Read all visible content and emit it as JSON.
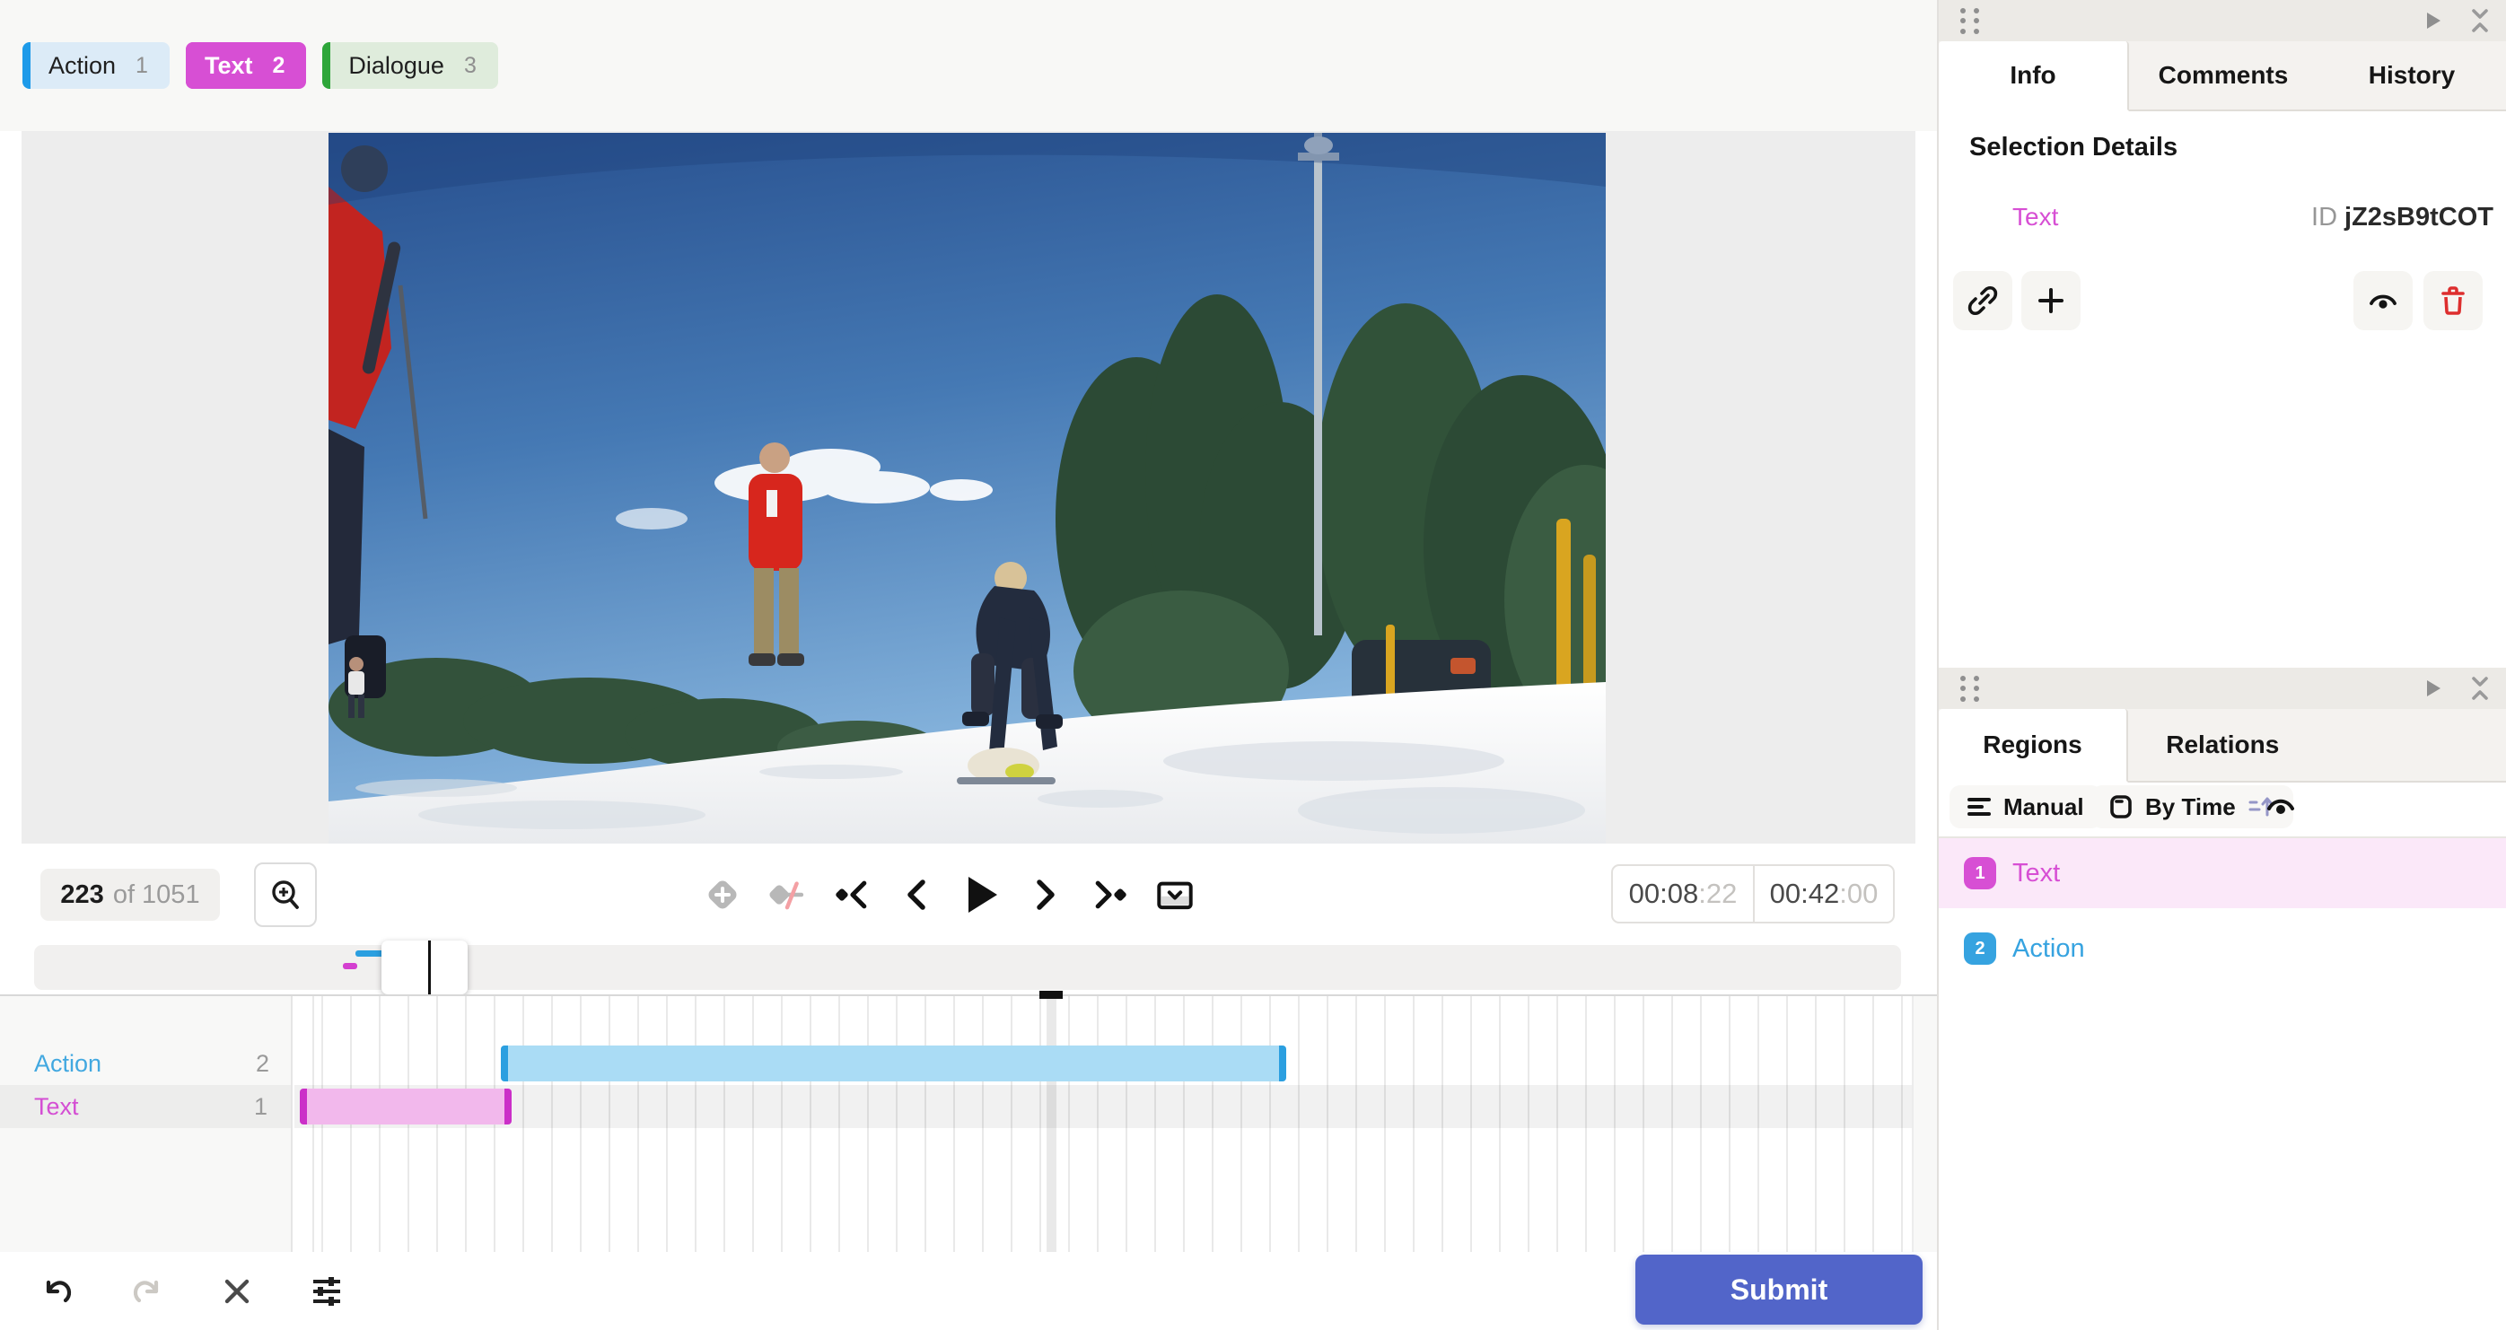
{
  "tags": [
    {
      "label": "Action",
      "count": "1",
      "accent": "#1e9be9",
      "bg": "#dcebf7",
      "selected": false
    },
    {
      "label": "Text",
      "count": "2",
      "accent": "#d74fd4",
      "bg": "#d74fd4",
      "selected": true
    },
    {
      "label": "Dialogue",
      "count": "3",
      "accent": "#2ea63a",
      "bg": "#dfecdc",
      "selected": false
    }
  ],
  "player": {
    "frame_current": "223",
    "frame_total_label": "of 1051",
    "time_position": {
      "main": "00:08",
      "frames": ":22"
    },
    "time_duration": {
      "main": "00:42",
      "frames": ":00"
    }
  },
  "timeline": {
    "tracks": [
      {
        "label": "Action",
        "count": "2",
        "color": "#42a8e0",
        "bar_color": "#aadcf5",
        "cap_color": "#2b9fe0"
      },
      {
        "label": "Text",
        "count": "1",
        "color": "#d44ed3",
        "bar_color": "#f2b8ec",
        "cap_color": "#cb2fc8"
      }
    ]
  },
  "details_panel": {
    "tabs": [
      {
        "label": "Info"
      },
      {
        "label": "Comments"
      },
      {
        "label": "History"
      }
    ],
    "active_tab": "Info",
    "heading": "Selection Details",
    "selection": {
      "label": "Text",
      "label_color": "#d74fd4",
      "id_label": "ID",
      "id_value": "jZ2sB9tCOT"
    }
  },
  "regions_panel": {
    "tabs": [
      {
        "label": "Regions"
      },
      {
        "label": "Relations"
      }
    ],
    "active_tab": "Regions",
    "toolbar": {
      "group_mode": "Manual",
      "sort_mode": "By Time"
    },
    "items": [
      {
        "index": "1",
        "label": "Text",
        "color": "#d74fd4",
        "selected": true
      },
      {
        "index": "2",
        "label": "Action",
        "color": "#36a3e0",
        "selected": false
      }
    ]
  },
  "footer": {
    "submit_label": "Submit"
  },
  "colors": {
    "submit_bg": "#5265c9",
    "delete_red": "#dd2e2e",
    "panel_header_bg": "#eceae6",
    "selected_row_bg": "#fbe8f9"
  }
}
